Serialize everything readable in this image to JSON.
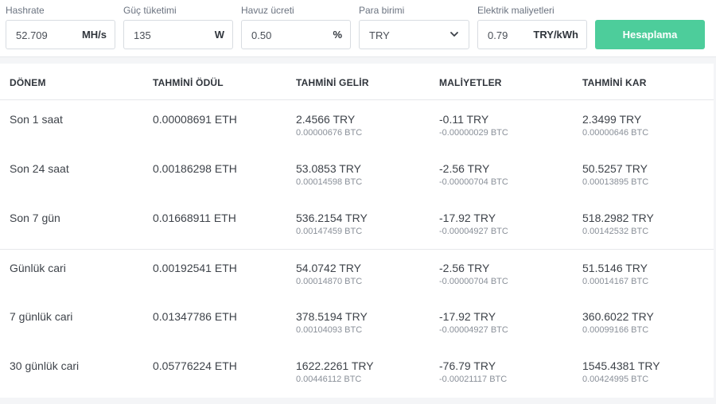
{
  "inputs": {
    "hashrate": {
      "label": "Hashrate",
      "value": "52.709",
      "unit": "MH/s"
    },
    "power": {
      "label": "Güç tüketimi",
      "value": "135",
      "unit": "W"
    },
    "pool_fee": {
      "label": "Havuz ücreti",
      "value": "0.50",
      "unit": "%"
    },
    "currency": {
      "label": "Para birimi",
      "value": "TRY"
    },
    "electricity": {
      "label": "Elektrik maliyetleri",
      "value": "0.79",
      "unit": "TRY/kWh"
    },
    "calculate_label": "Hesaplama"
  },
  "table": {
    "headers": [
      "DÖNEM",
      "TAHMİNİ ÖDÜL",
      "TAHMİNİ GELİR",
      "MALİYETLER",
      "TAHMİNİ KAR"
    ],
    "rows": [
      {
        "period": "Son 1 saat",
        "reward": "0.00008691 ETH",
        "revenue": "2.4566 TRY",
        "revenue_btc": "0.00000676 BTC",
        "cost": "-0.11 TRY",
        "cost_btc": "-0.00000029 BTC",
        "profit": "2.3499 TRY",
        "profit_btc": "0.00000646 BTC"
      },
      {
        "period": "Son 24 saat",
        "reward": "0.00186298 ETH",
        "revenue": "53.0853 TRY",
        "revenue_btc": "0.00014598 BTC",
        "cost": "-2.56 TRY",
        "cost_btc": "-0.00000704 BTC",
        "profit": "50.5257 TRY",
        "profit_btc": "0.00013895 BTC"
      },
      {
        "period": "Son 7 gün",
        "reward": "0.01668911 ETH",
        "revenue": "536.2154 TRY",
        "revenue_btc": "0.00147459 BTC",
        "cost": "-17.92 TRY",
        "cost_btc": "-0.00004927 BTC",
        "profit": "518.2982 TRY",
        "profit_btc": "0.00142532 BTC"
      },
      {
        "period": "Günlük cari",
        "reward": "0.00192541 ETH",
        "revenue": "54.0742 TRY",
        "revenue_btc": "0.00014870 BTC",
        "cost": "-2.56 TRY",
        "cost_btc": "-0.00000704 BTC",
        "profit": "51.5146 TRY",
        "profit_btc": "0.00014167 BTC"
      },
      {
        "period": "7 günlük cari",
        "reward": "0.01347786 ETH",
        "revenue": "378.5194 TRY",
        "revenue_btc": "0.00104093 BTC",
        "cost": "-17.92 TRY",
        "cost_btc": "-0.00004927 BTC",
        "profit": "360.6022 TRY",
        "profit_btc": "0.00099166 BTC"
      },
      {
        "period": "30 günlük cari",
        "reward": "0.05776224 ETH",
        "revenue": "1622.2261 TRY",
        "revenue_btc": "0.00446112 BTC",
        "cost": "-76.79 TRY",
        "cost_btc": "-0.00021117 BTC",
        "profit": "1545.4381 TRY",
        "profit_btc": "0.00424995 BTC"
      }
    ]
  },
  "colors": {
    "accent": "#4dcd9b"
  }
}
